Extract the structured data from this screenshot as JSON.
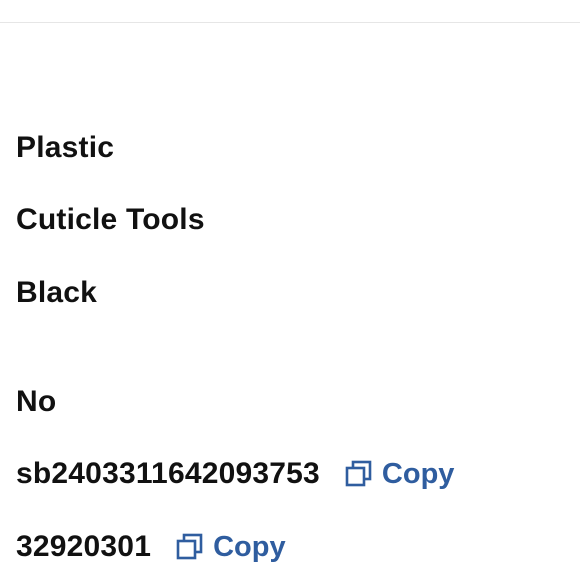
{
  "details": {
    "material": "Plastic",
    "category": "Cuticle Tools",
    "color": "Black",
    "flag": "No",
    "sku": {
      "value": "sb2403311642093753",
      "copy_label": "Copy"
    },
    "id": {
      "value": "32920301",
      "copy_label": "Copy"
    }
  },
  "colors": {
    "text": "#111111",
    "link": "#2f5d9f",
    "divider": "#e6e6e6"
  },
  "icons": {
    "copy": "copy-icon"
  }
}
